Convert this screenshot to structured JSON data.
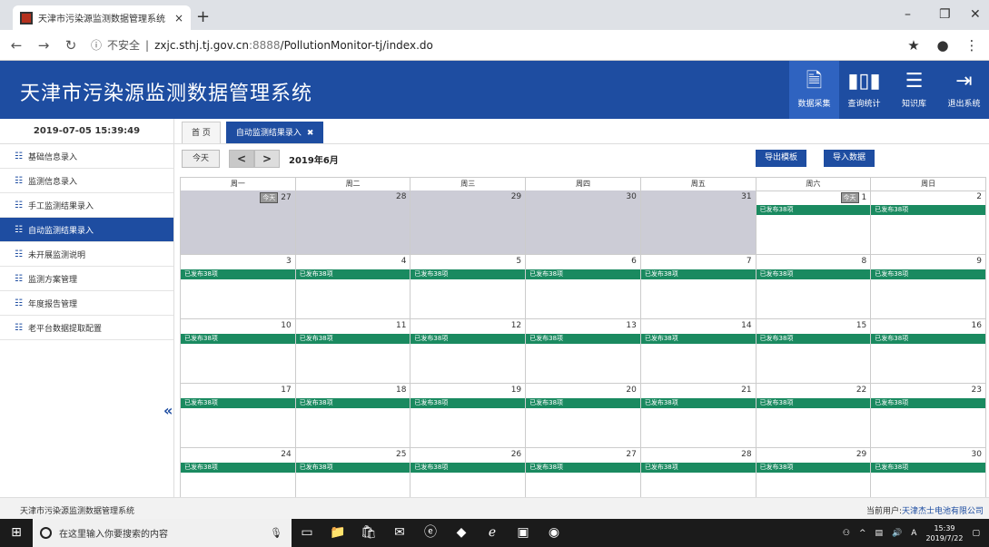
{
  "browser": {
    "tab_title": "天津市污染源监测数据管理系统",
    "tab_close": "×",
    "new_tab": "+",
    "security_label": "不安全",
    "url_host": "zxjc.sthj.tj.gov.cn",
    "url_port": ":8888",
    "url_path": "/PollutionMonitor-tj/index.do"
  },
  "app": {
    "title": "天津市污染源监测数据管理系统",
    "top_nav": [
      {
        "label": "数据采集",
        "icon": "data-entry-icon",
        "active": true
      },
      {
        "label": "查询统计",
        "icon": "bar-chart-icon",
        "active": false
      },
      {
        "label": "知识库",
        "icon": "database-icon",
        "active": false
      },
      {
        "label": "退出系统",
        "icon": "logout-icon",
        "active": false
      }
    ]
  },
  "sidebar": {
    "datetime": "2019-07-05 15:39:49",
    "items": [
      {
        "label": "基础信息录入",
        "active": false
      },
      {
        "label": "监测信息录入",
        "active": false
      },
      {
        "label": "手工监测结果录入",
        "active": false
      },
      {
        "label": "自动监测结果录入",
        "active": true
      },
      {
        "label": "未开展监测说明",
        "active": false
      },
      {
        "label": "监测方案管理",
        "active": false
      },
      {
        "label": "年度报告管理",
        "active": false
      },
      {
        "label": "老平台数据提取配置",
        "active": false
      }
    ],
    "collapse_icon": "«"
  },
  "content": {
    "tabs": [
      {
        "label": "首 页",
        "active": false
      },
      {
        "label": "自动监测结果录入",
        "active": true,
        "close": "✖"
      }
    ],
    "toolbar": {
      "today": "今天",
      "prev": "<",
      "next": ">",
      "month": "2019年6月",
      "export_template": "导出模板",
      "import_data": "导入数据"
    },
    "weekdays": [
      "周一",
      "周二",
      "周三",
      "周四",
      "周五",
      "周六",
      "周日"
    ],
    "today_mark": "今天",
    "event_label": "已发布38项",
    "days": [
      {
        "n": "27",
        "other": true,
        "ev": false,
        "mark": true
      },
      {
        "n": "28",
        "other": true,
        "ev": false
      },
      {
        "n": "29",
        "other": true,
        "ev": false
      },
      {
        "n": "30",
        "other": true,
        "ev": false
      },
      {
        "n": "31",
        "other": true,
        "ev": false
      },
      {
        "n": "1",
        "other": false,
        "ev": true,
        "mark": true
      },
      {
        "n": "2",
        "other": false,
        "ev": true
      },
      {
        "n": "3",
        "other": false,
        "ev": true
      },
      {
        "n": "4",
        "other": false,
        "ev": true
      },
      {
        "n": "5",
        "other": false,
        "ev": true
      },
      {
        "n": "6",
        "other": false,
        "ev": true
      },
      {
        "n": "7",
        "other": false,
        "ev": true
      },
      {
        "n": "8",
        "other": false,
        "ev": true
      },
      {
        "n": "9",
        "other": false,
        "ev": true
      },
      {
        "n": "10",
        "other": false,
        "ev": true
      },
      {
        "n": "11",
        "other": false,
        "ev": true
      },
      {
        "n": "12",
        "other": false,
        "ev": true
      },
      {
        "n": "13",
        "other": false,
        "ev": true
      },
      {
        "n": "14",
        "other": false,
        "ev": true
      },
      {
        "n": "15",
        "other": false,
        "ev": true
      },
      {
        "n": "16",
        "other": false,
        "ev": true
      },
      {
        "n": "17",
        "other": false,
        "ev": true
      },
      {
        "n": "18",
        "other": false,
        "ev": true
      },
      {
        "n": "19",
        "other": false,
        "ev": true
      },
      {
        "n": "20",
        "other": false,
        "ev": true
      },
      {
        "n": "21",
        "other": false,
        "ev": true
      },
      {
        "n": "22",
        "other": false,
        "ev": true
      },
      {
        "n": "23",
        "other": false,
        "ev": true
      },
      {
        "n": "24",
        "other": false,
        "ev": true
      },
      {
        "n": "25",
        "other": false,
        "ev": true
      },
      {
        "n": "26",
        "other": false,
        "ev": true
      },
      {
        "n": "27",
        "other": false,
        "ev": true
      },
      {
        "n": "28",
        "other": false,
        "ev": true
      },
      {
        "n": "29",
        "other": false,
        "ev": true
      },
      {
        "n": "30",
        "other": false,
        "ev": true
      }
    ]
  },
  "footer": {
    "left": "天津市污染源监测数据管理系统",
    "user_label": "当前用户:",
    "company": "天津杰士电池有限公司"
  },
  "taskbar": {
    "search_placeholder": "在这里输入你要搜索的内容",
    "time": "15:39",
    "date": "2019/7/22",
    "ime": "A"
  },
  "colors": {
    "brand": "#1e4da1",
    "event": "#1a8a60",
    "other_month": "#ccccd6"
  }
}
